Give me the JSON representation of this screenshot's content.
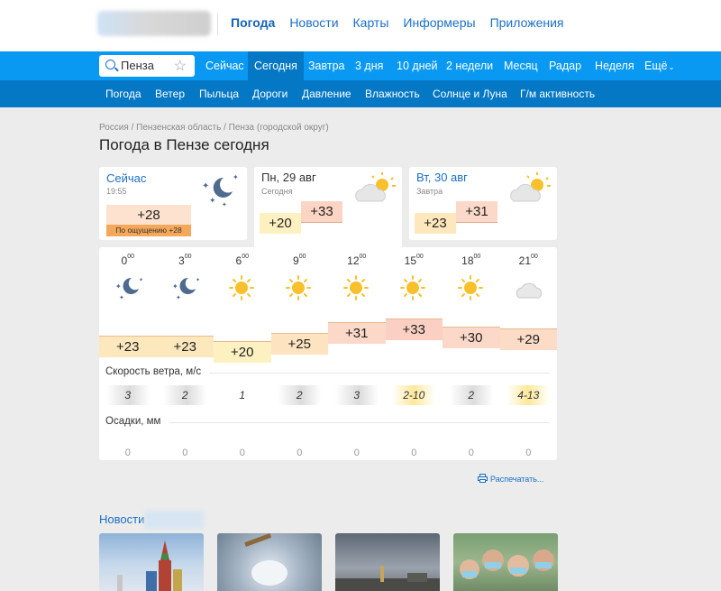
{
  "top_nav": [
    "Погода",
    "Новости",
    "Карты",
    "Информеры",
    "Приложения"
  ],
  "search": {
    "value": "Пенза"
  },
  "tabs": [
    "Сейчас",
    "Сегодня",
    "Завтра",
    "3 дня",
    "10 дней",
    "2 недели",
    "Месяц",
    "Радар",
    "Неделя",
    "Ещё"
  ],
  "sub_nav": [
    "Погода",
    "Ветер",
    "Пыльца",
    "Дороги",
    "Давление",
    "Влажность",
    "Солнце и Луна",
    "Г/м активность"
  ],
  "breadcrumb": "Россия / Пензенская область / Пенза (городской округ)",
  "page_title": "Погода в Пензе сегодня",
  "now": {
    "label": "Сейчас",
    "time": "19:55",
    "temp": "+28",
    "feels": "По ощущению +28",
    "icon": "moon-stars-icon"
  },
  "today": {
    "date": "Пн, 29 авг",
    "sub": "Сегодня",
    "low": "+20",
    "high": "+33",
    "icon": "sun-cloud-icon"
  },
  "tomorrow": {
    "date": "Вт, 30 авг",
    "sub": "Завтра",
    "low": "+23",
    "high": "+31",
    "icon": "sun-cloud-icon"
  },
  "hourly": [
    {
      "h": "0",
      "m": "00",
      "icon": "moon-stars-icon",
      "temp": "+23",
      "wind": "3",
      "precip": "0"
    },
    {
      "h": "3",
      "m": "00",
      "icon": "moon-stars-icon",
      "temp": "+23",
      "wind": "2",
      "precip": "0"
    },
    {
      "h": "6",
      "m": "00",
      "icon": "sun-icon",
      "temp": "+20",
      "wind": "1",
      "precip": "0"
    },
    {
      "h": "9",
      "m": "00",
      "icon": "sun-icon",
      "temp": "+25",
      "wind": "2",
      "precip": "0"
    },
    {
      "h": "12",
      "m": "00",
      "icon": "sun-icon",
      "temp": "+31",
      "wind": "3",
      "precip": "0"
    },
    {
      "h": "15",
      "m": "00",
      "icon": "sun-icon",
      "temp": "+33",
      "wind": "2-10",
      "precip": "0"
    },
    {
      "h": "18",
      "m": "00",
      "icon": "sun-icon",
      "temp": "+30",
      "wind": "2",
      "precip": "0"
    },
    {
      "h": "21",
      "m": "00",
      "icon": "cloud-icon",
      "temp": "+29",
      "wind": "4-13",
      "precip": "0"
    }
  ],
  "wind_label": "Скорость ветра, м/с",
  "precip_label": "Осадки, мм",
  "print_label": "Распечатать...",
  "news_title": "Новости",
  "colors": {
    "accent": "#0a99f2",
    "accent_dark": "#0478c4",
    "link": "#1a6fc7",
    "sun": "#f8c12b"
  }
}
